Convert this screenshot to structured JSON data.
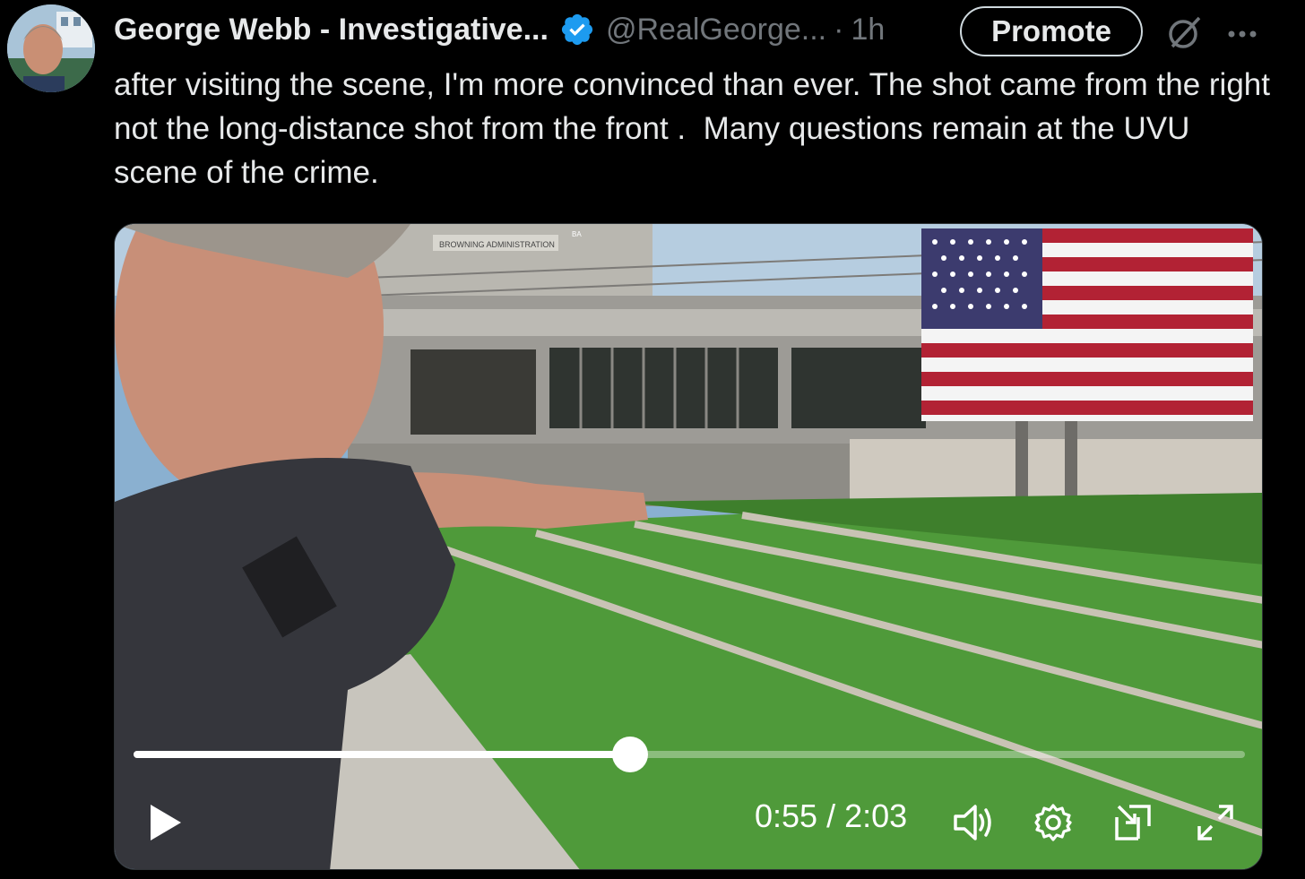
{
  "author": {
    "name": "George Webb - Investigative...",
    "handle": "@RealGeorge...",
    "separator": "·",
    "time": "1h"
  },
  "promote_label": "Promote",
  "tweet_text": "after visiting the scene, I'm more convinced than ever. The shot came from the right not the long-distance shot from the front .  Many questions remain at the UVU  scene of the crime.",
  "video": {
    "building_sign": "BROWNING ADMINISTRATION",
    "building_code": "BA",
    "current_time": "0:55",
    "duration": "2:03",
    "timecode": "0:55 / 2:03",
    "progress": 0.447
  },
  "icons": {
    "verified": "verified-badge-icon",
    "grok": "grok-icon",
    "more": "more-options-icon",
    "play": "play-icon",
    "volume": "volume-icon",
    "settings": "settings-gear-icon",
    "pip": "picture-in-picture-icon",
    "fullscreen": "fullscreen-icon"
  },
  "colors": {
    "background": "#000000",
    "text": "#e7e9ea",
    "muted": "#71767b",
    "verified": "#1d9bf0"
  }
}
